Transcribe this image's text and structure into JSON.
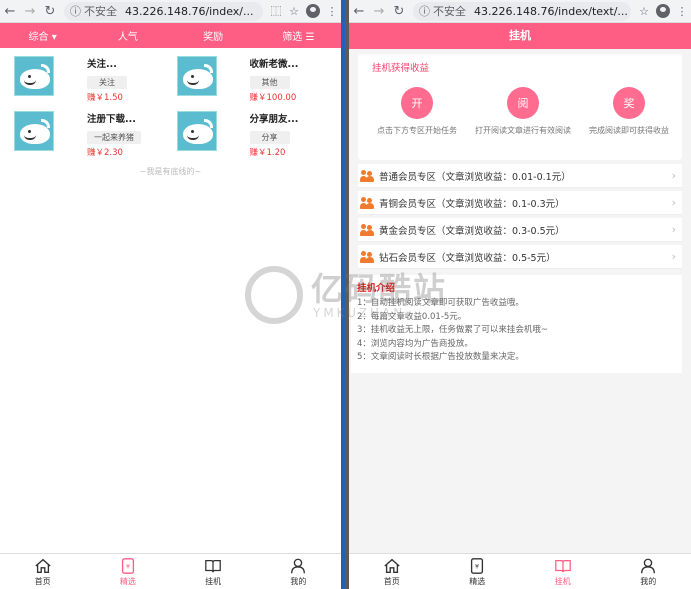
{
  "browser": {
    "left": {
      "insecure_label": "不安全",
      "url": "43.226.148.76/index/..."
    },
    "right": {
      "insecure_label": "不安全",
      "url": "43.226.148.76/index/text/..."
    }
  },
  "left": {
    "tabs": [
      {
        "label": "综合 ▾"
      },
      {
        "label": "人气"
      },
      {
        "label": "奖励"
      },
      {
        "label": "筛选 ☰"
      }
    ],
    "cards": [
      {
        "title": "关注...",
        "tag": "关注",
        "earn": "赚￥1.50"
      },
      {
        "title": "收新老微...",
        "tag": "其他",
        "earn": "赚￥100.00"
      },
      {
        "title": "注册下载...",
        "tag": "一起来养猪",
        "earn": "赚￥2.30"
      },
      {
        "title": "分享朋友...",
        "tag": "分享",
        "earn": "赚￥1.20"
      }
    ],
    "no_more": "~我是有底线的~"
  },
  "right": {
    "title": "挂机",
    "earn_title": "挂机获得收益",
    "steps": [
      {
        "circle": "开",
        "text": "点击下方专区开始任务"
      },
      {
        "circle": "阅",
        "text": "打开阅读文章进行有效阅读"
      },
      {
        "circle": "奖",
        "text": "完成阅读即可获得收益"
      }
    ],
    "zones": [
      {
        "label": "普通会员专区（文章浏览收益：0.01-0.1元）"
      },
      {
        "label": "青铜会员专区（文章浏览收益：0.1-0.3元）"
      },
      {
        "label": "黄金会员专区（文章浏览收益：0.3-0.5元）"
      },
      {
        "label": "钻石会员专区（文章浏览收益：0.5-5元）"
      }
    ],
    "intro_title": "挂机介绍",
    "intro_lines": [
      "1：自动挂机阅读文章即可获取广告收益哦。",
      "2：每篇文章收益0.01-5元。",
      "3：挂机收益无上限，任务做累了可以来挂会机哦~",
      "4：浏览内容均为广告商投放。",
      "5：文章阅读时长根据广告投放数量来决定。"
    ]
  },
  "bottom_nav": [
    {
      "label": "首页",
      "icon": "home-icon"
    },
    {
      "label": "精选",
      "icon": "selected-icon"
    },
    {
      "label": "挂机",
      "icon": "book-icon"
    },
    {
      "label": "我的",
      "icon": "user-icon"
    }
  ],
  "watermark": {
    "main": "亿码酷站",
    "sub": "YMKUZHAN"
  }
}
